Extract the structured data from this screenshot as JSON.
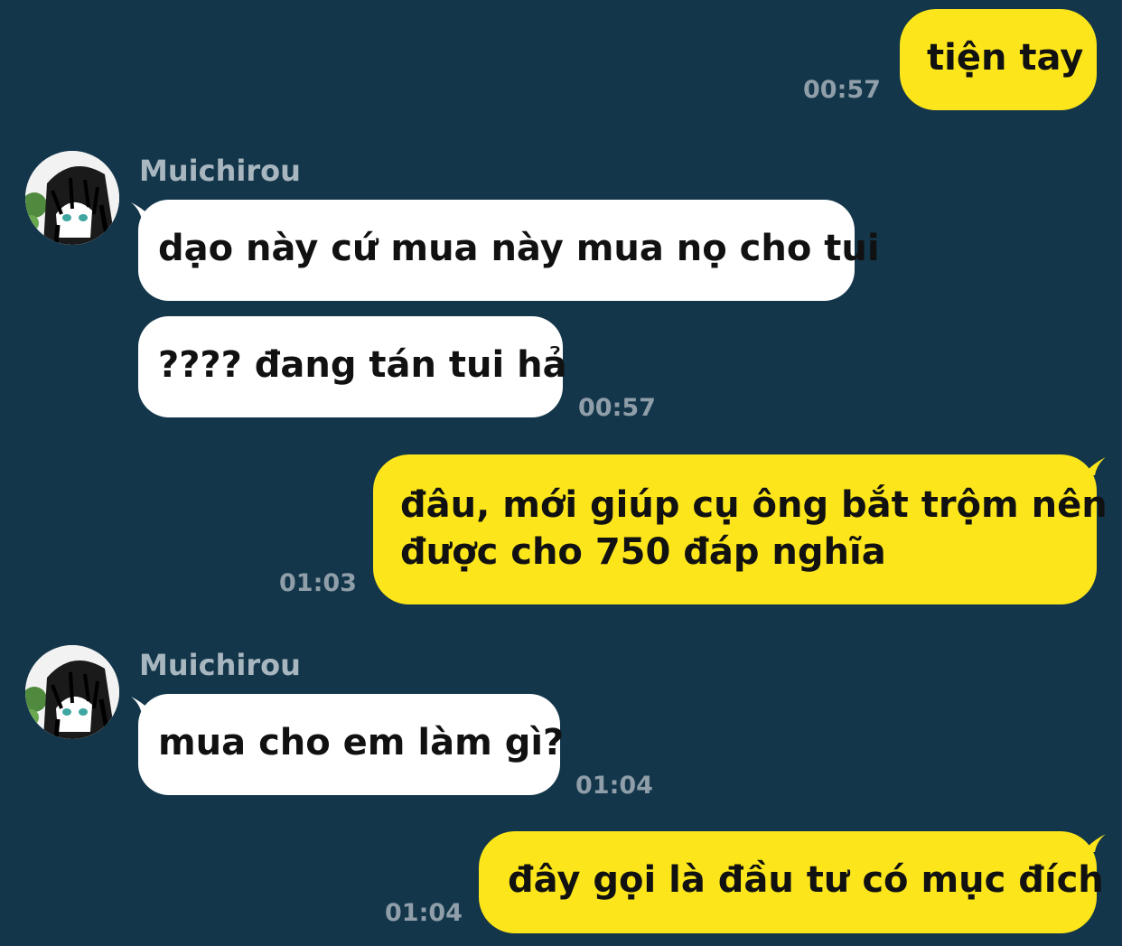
{
  "colors": {
    "background": "#13364a",
    "outgoing_bubble": "#fce61b",
    "incoming_bubble": "#ffffff",
    "timestamp": "#8f9ea9",
    "sender_name": "#a8b6bf"
  },
  "messages": [
    {
      "direction": "out",
      "text": "tiện tay",
      "time": "00:57"
    },
    {
      "direction": "in",
      "sender": "Muichirou",
      "avatar_icon": "anime-avatar-icon",
      "text": "dạo này cứ mua này mua nọ cho tui"
    },
    {
      "direction": "in",
      "text": "???? đang tán tui hả",
      "time": "00:57"
    },
    {
      "direction": "out",
      "text_lines": [
        "đâu, mới giúp cụ ông bắt trộm nên",
        "được cho 750 đáp nghĩa"
      ],
      "time": "01:03"
    },
    {
      "direction": "in",
      "sender": "Muichirou",
      "avatar_icon": "anime-avatar-icon",
      "text": "mua cho em làm gì?",
      "time": "01:04"
    },
    {
      "direction": "out",
      "text": "đây gọi là đầu tư có mục đích",
      "time": "01:04"
    }
  ]
}
